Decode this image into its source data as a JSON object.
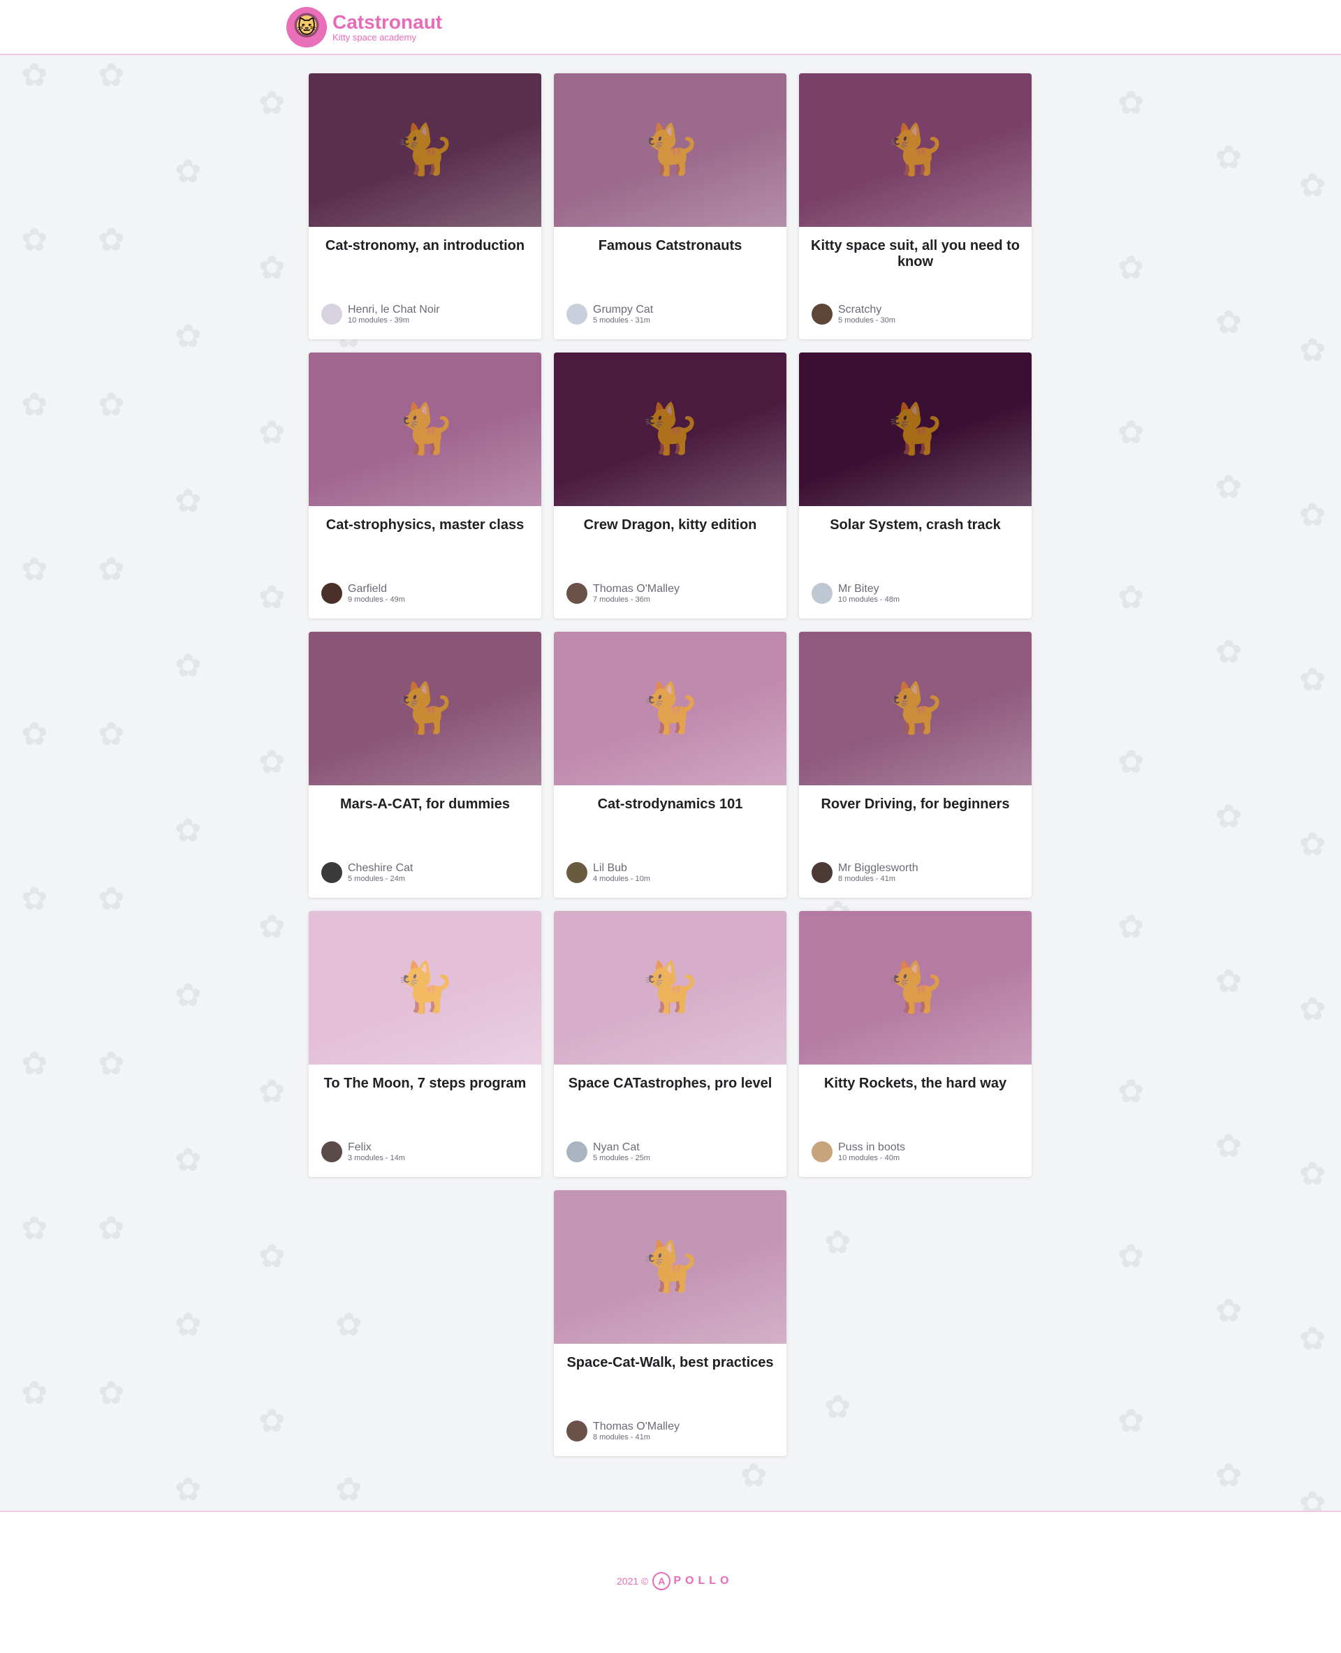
{
  "header": {
    "title": "Catstronaut",
    "subtitle": "Kitty space academy",
    "logo_icon": "cat-astronaut-icon"
  },
  "tracks": [
    {
      "title": "Cat-stronomy, an introduction",
      "author": "Henri, le Chat Noir",
      "meta": "10 modules - 39m",
      "thumb_color": "#5a2f4d",
      "avatar_color": "#d8d2e0"
    },
    {
      "title": "Famous Catstronauts",
      "author": "Grumpy Cat",
      "meta": "5 modules - 31m",
      "thumb_color": "#9b6a8c",
      "avatar_color": "#c9d0dc"
    },
    {
      "title": "Kitty space suit, all you need to know",
      "author": "Scratchy",
      "meta": "5 modules - 30m",
      "thumb_color": "#7a4068",
      "avatar_color": "#5e4636"
    },
    {
      "title": "Cat-strophysics, master class",
      "author": "Garfield",
      "meta": "9 modules - 49m",
      "thumb_color": "#a16690",
      "avatar_color": "#4a3028"
    },
    {
      "title": "Crew Dragon, kitty edition",
      "author": "Thomas O'Malley",
      "meta": "7 modules - 36m",
      "thumb_color": "#4a1b3f",
      "avatar_color": "#6a5248"
    },
    {
      "title": "Solar System, crash track",
      "author": "Mr Bitey",
      "meta": "10 modules - 48m",
      "thumb_color": "#3a0f33",
      "avatar_color": "#bfc7d2"
    },
    {
      "title": "Mars-A-CAT, for dummies",
      "author": "Cheshire Cat",
      "meta": "5 modules - 24m",
      "thumb_color": "#8a5577",
      "avatar_color": "#3a3a3a"
    },
    {
      "title": "Cat-strodynamics 101",
      "author": "Lil Bub",
      "meta": "4 modules - 10m",
      "thumb_color": "#c08aae",
      "avatar_color": "#6a5a40"
    },
    {
      "title": "Rover Driving, for beginners",
      "author": "Mr Bigglesworth",
      "meta": "8 modules - 41m",
      "thumb_color": "#8f5a7e",
      "avatar_color": "#4c3a36"
    },
    {
      "title": "To The Moon, 7 steps program",
      "author": "Felix",
      "meta": "3 modules - 14m",
      "thumb_color": "#e3bfd8",
      "avatar_color": "#5a4a48"
    },
    {
      "title": "Space CATastrophes, pro level",
      "author": "Nyan Cat",
      "meta": "5 modules - 25m",
      "thumb_color": "#d6aec9",
      "avatar_color": "#a9b4c0"
    },
    {
      "title": "Kitty Rockets, the hard way",
      "author": "Puss in boots",
      "meta": "10 modules - 40m",
      "thumb_color": "#b57ba2",
      "avatar_color": "#c8a47c"
    },
    {
      "title": "Space-Cat-Walk, best practices",
      "author": "Thomas O'Malley",
      "meta": "8 modules - 41m",
      "thumb_color": "#c496b5",
      "avatar_color": "#6a5248"
    }
  ],
  "footer": {
    "year": "2021 ©",
    "brand_mark": "A",
    "brand_word": "POLLO"
  }
}
